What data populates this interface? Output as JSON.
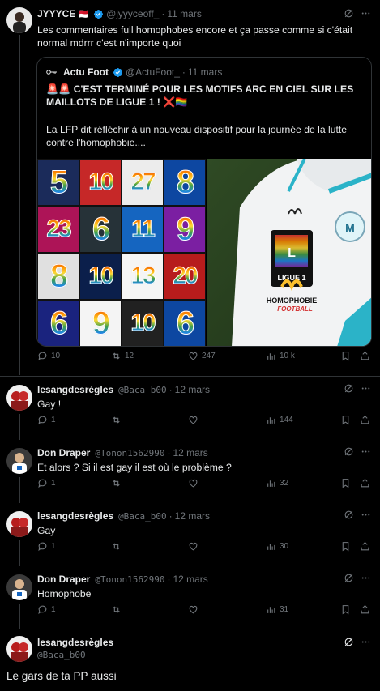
{
  "colors": {
    "bg": "#000000",
    "text": "#e7e9ea",
    "muted": "#71767b",
    "border": "#2f3336",
    "verified": "#1d9bf0",
    "heart_pink": "#f91880"
  },
  "main_tweet": {
    "name": "JYYYCE",
    "name_flag": "🇲🇨",
    "handle": "@jyyyceoff_",
    "date": "11 mars",
    "text": "Les commentaires full homophobes encore et ça passe comme si c'était normal mdrrr c'est n'importe quoi",
    "quote": {
      "name": "Actu Foot",
      "handle": "@ActuFoot_",
      "date": "11 mars",
      "headline": "🚨🚨 C'EST TERMINÉ POUR LES MOTIFS ARC EN CIEL SUR LES MAILLOTS DE LIGUE 1 ! ❌🏳️‍🌈",
      "body": "La LFP dit réfléchir à un nouveau dispositif pour la journée de la lutte contre l'homophobie....",
      "image_numbers": [
        "5",
        "10",
        "27",
        "8",
        "23",
        "6",
        "11",
        "9",
        "8",
        "10",
        "13",
        "20",
        "6",
        "9",
        "10",
        "6"
      ],
      "shirt_patch": "LIGUE 1",
      "shirt_text_1": "HOMOPHOBIE",
      "shirt_text_2": "FOOTBALL"
    },
    "stats": {
      "replies": "10",
      "reposts": "12",
      "likes": "247",
      "views": "10 k"
    }
  },
  "replies": [
    {
      "name": "lesangdesrègles",
      "handle": "@Baca_b00",
      "date": "12 mars",
      "text": "Gay !",
      "replies": "1",
      "likes": "",
      "views": "144"
    },
    {
      "name": "Don Draper",
      "handle": "@Tonon1562990",
      "date": "12 mars",
      "text": "Et alors ? Si il est gay il est où le problème ?",
      "replies": "1",
      "likes": "",
      "views": "32"
    },
    {
      "name": "lesangdesrègles",
      "handle": "@Baca_b00",
      "date": "12 mars",
      "text": "Gay",
      "replies": "1",
      "likes": "",
      "views": "30"
    },
    {
      "name": "Don Draper",
      "handle": "@Tonon1562990",
      "date": "12 mars",
      "text": "Homophobe",
      "replies": "1",
      "likes": "",
      "views": "31"
    }
  ],
  "focused_tweet": {
    "name": "lesangdesrègles",
    "handle": "@Baca_b00",
    "text": "Le gars de ta PP aussi"
  }
}
